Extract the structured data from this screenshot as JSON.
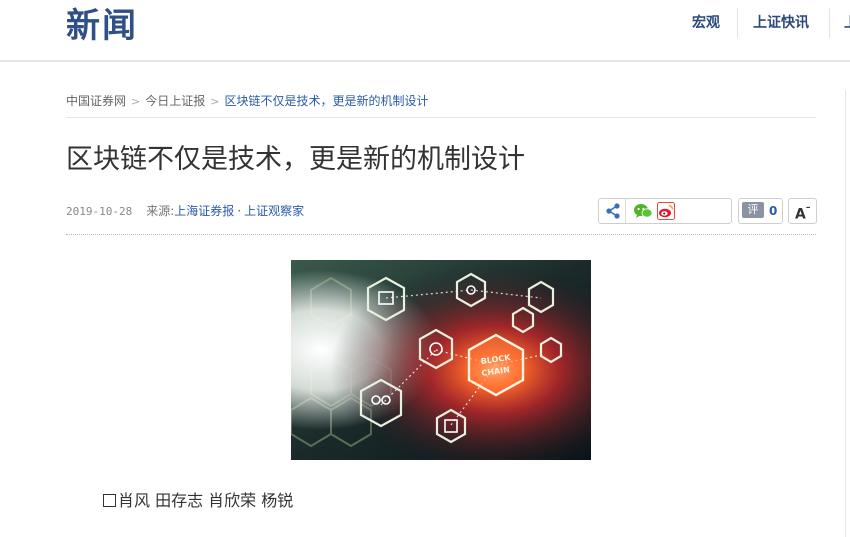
{
  "header": {
    "logo_text": "新闻",
    "nav": [
      {
        "label": "宏观"
      },
      {
        "label": "上证快讯"
      }
    ],
    "brand_color": "#2f4f86"
  },
  "breadcrumb": {
    "items": [
      "中国证券网",
      "今日上证报",
      "区块链不仅是技术，更是新的机制设计"
    ],
    "separator_icon": "chevron-right-icon"
  },
  "article": {
    "title": "区块链不仅是技术，更是新的机制设计",
    "date": "2019-10-28",
    "source_label": "来源:",
    "source": "上海证券报",
    "source_separator": "·",
    "column": "上证观察家",
    "image_label": "BLOCK CHAIN",
    "authors": "肖风  田存志  肖欣荣  杨锐"
  },
  "toolbar": {
    "share_icon": "share-icon",
    "wechat_icon": "wechat-icon",
    "weibo_icon": "weibo-icon",
    "comment_label": "评",
    "comment_count": "0",
    "font_size_label": "A"
  },
  "colors": {
    "link": "#2b5aa8",
    "text": "#333333",
    "muted": "#777777"
  }
}
